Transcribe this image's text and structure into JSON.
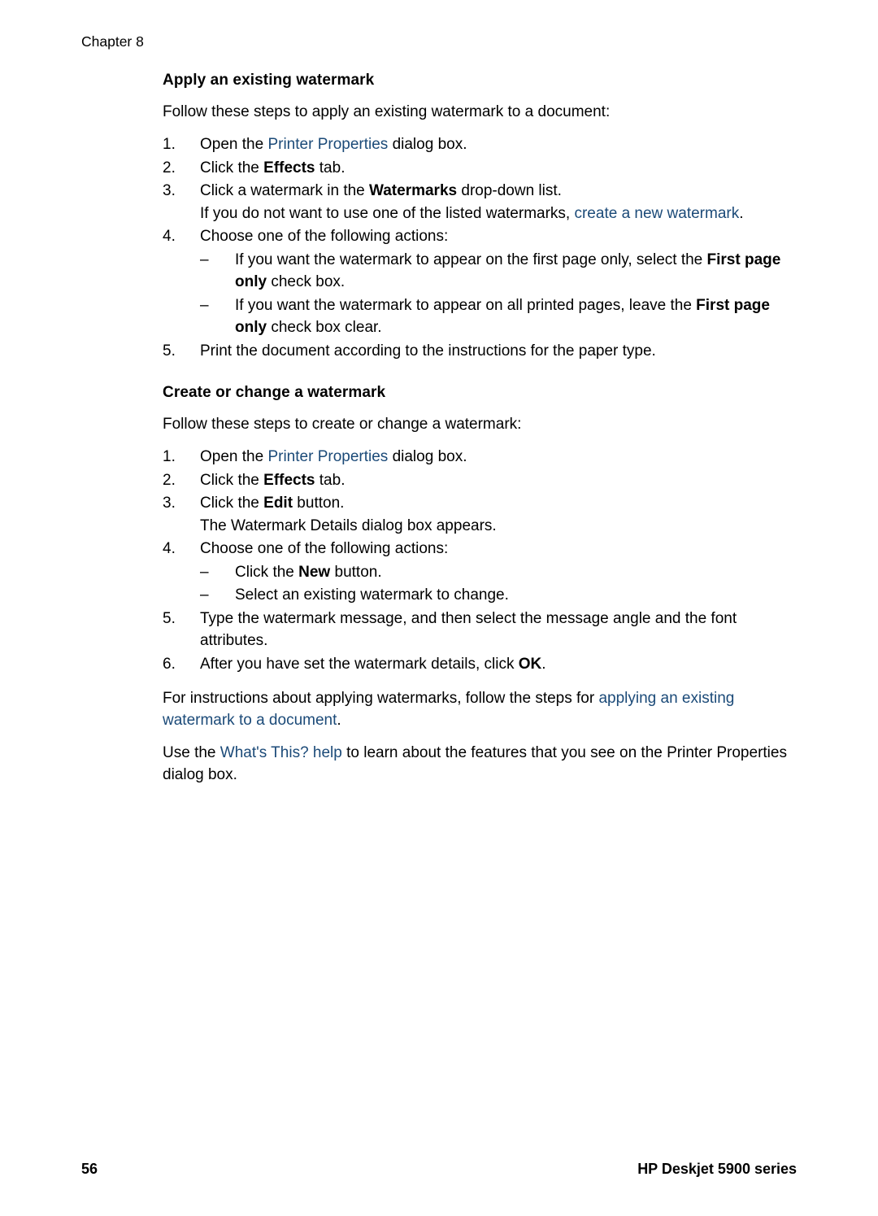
{
  "header": {
    "chapter_label": "Chapter 8"
  },
  "colors": {
    "link": "#1b4a78",
    "text": "#000000",
    "background": "#ffffff"
  },
  "sections": [
    {
      "heading": "Apply an existing watermark",
      "intro": "Follow these steps to apply an existing watermark to a document:",
      "steps": [
        {
          "marker": "1.",
          "parts": [
            {
              "text": "Open the ",
              "style": "normal"
            },
            {
              "text": "Printer Properties",
              "style": "link"
            },
            {
              "text": " dialog box.",
              "style": "normal"
            }
          ]
        },
        {
          "marker": "2.",
          "parts": [
            {
              "text": "Click the ",
              "style": "normal"
            },
            {
              "text": "Effects",
              "style": "bold"
            },
            {
              "text": " tab.",
              "style": "normal"
            }
          ]
        },
        {
          "marker": "3.",
          "parts": [
            {
              "text": "Click a watermark in the ",
              "style": "normal"
            },
            {
              "text": "Watermarks",
              "style": "bold"
            },
            {
              "text": " drop-down list.",
              "style": "normal"
            }
          ],
          "continuation": [
            {
              "text": "If you do not want to use one of the listed watermarks, ",
              "style": "normal"
            },
            {
              "text": "create a new watermark",
              "style": "link"
            },
            {
              "text": ".",
              "style": "normal"
            }
          ]
        },
        {
          "marker": "4.",
          "parts": [
            {
              "text": "Choose one of the following actions:",
              "style": "normal"
            }
          ],
          "dashes": [
            {
              "dash": "–",
              "parts": [
                {
                  "text": "If you want the watermark to appear on the first page only, select the ",
                  "style": "normal"
                },
                {
                  "text": "First page only",
                  "style": "bold"
                },
                {
                  "text": " check box.",
                  "style": "normal"
                }
              ]
            },
            {
              "dash": "–",
              "parts": [
                {
                  "text": "If you want the watermark to appear on all printed pages, leave the ",
                  "style": "normal"
                },
                {
                  "text": "First page only",
                  "style": "bold"
                },
                {
                  "text": " check box clear.",
                  "style": "normal"
                }
              ]
            }
          ]
        },
        {
          "marker": "5.",
          "parts": [
            {
              "text": "Print the document according to the instructions for the paper type.",
              "style": "normal"
            }
          ]
        }
      ]
    },
    {
      "heading": "Create or change a watermark",
      "intro": "Follow these steps to create or change a watermark:",
      "steps": [
        {
          "marker": "1.",
          "parts": [
            {
              "text": "Open the ",
              "style": "normal"
            },
            {
              "text": "Printer Properties",
              "style": "link"
            },
            {
              "text": " dialog box.",
              "style": "normal"
            }
          ]
        },
        {
          "marker": "2.",
          "parts": [
            {
              "text": "Click the ",
              "style": "normal"
            },
            {
              "text": "Effects",
              "style": "bold"
            },
            {
              "text": " tab.",
              "style": "normal"
            }
          ]
        },
        {
          "marker": "3.",
          "parts": [
            {
              "text": "Click the ",
              "style": "normal"
            },
            {
              "text": "Edit",
              "style": "bold"
            },
            {
              "text": " button.",
              "style": "normal"
            }
          ],
          "continuation": [
            {
              "text": "The Watermark Details dialog box appears.",
              "style": "normal"
            }
          ]
        },
        {
          "marker": "4.",
          "parts": [
            {
              "text": "Choose one of the following actions:",
              "style": "normal"
            }
          ],
          "dashes": [
            {
              "dash": "–",
              "parts": [
                {
                  "text": "Click the ",
                  "style": "normal"
                },
                {
                  "text": "New",
                  "style": "bold"
                },
                {
                  "text": " button.",
                  "style": "normal"
                }
              ]
            },
            {
              "dash": "–",
              "parts": [
                {
                  "text": "Select an existing watermark to change.",
                  "style": "normal"
                }
              ]
            }
          ]
        },
        {
          "marker": "5.",
          "parts": [
            {
              "text": "Type the watermark message, and then select the message angle and the font attributes.",
              "style": "normal"
            }
          ]
        },
        {
          "marker": "6.",
          "parts": [
            {
              "text": "After you have set the watermark details, click ",
              "style": "normal"
            },
            {
              "text": "OK",
              "style": "bold"
            },
            {
              "text": ".",
              "style": "normal"
            }
          ]
        }
      ],
      "trailing_paragraphs": [
        [
          {
            "text": "For instructions about applying watermarks, follow the steps for ",
            "style": "normal"
          },
          {
            "text": "applying an existing watermark to a document",
            "style": "link"
          },
          {
            "text": ".",
            "style": "normal"
          }
        ],
        [
          {
            "text": "Use the ",
            "style": "normal"
          },
          {
            "text": "What's This? help",
            "style": "link"
          },
          {
            "text": " to learn about the features that you see on the Printer Properties dialog box.",
            "style": "normal"
          }
        ]
      ]
    }
  ],
  "footer": {
    "page_number": "56",
    "product_name": "HP Deskjet 5900 series"
  }
}
